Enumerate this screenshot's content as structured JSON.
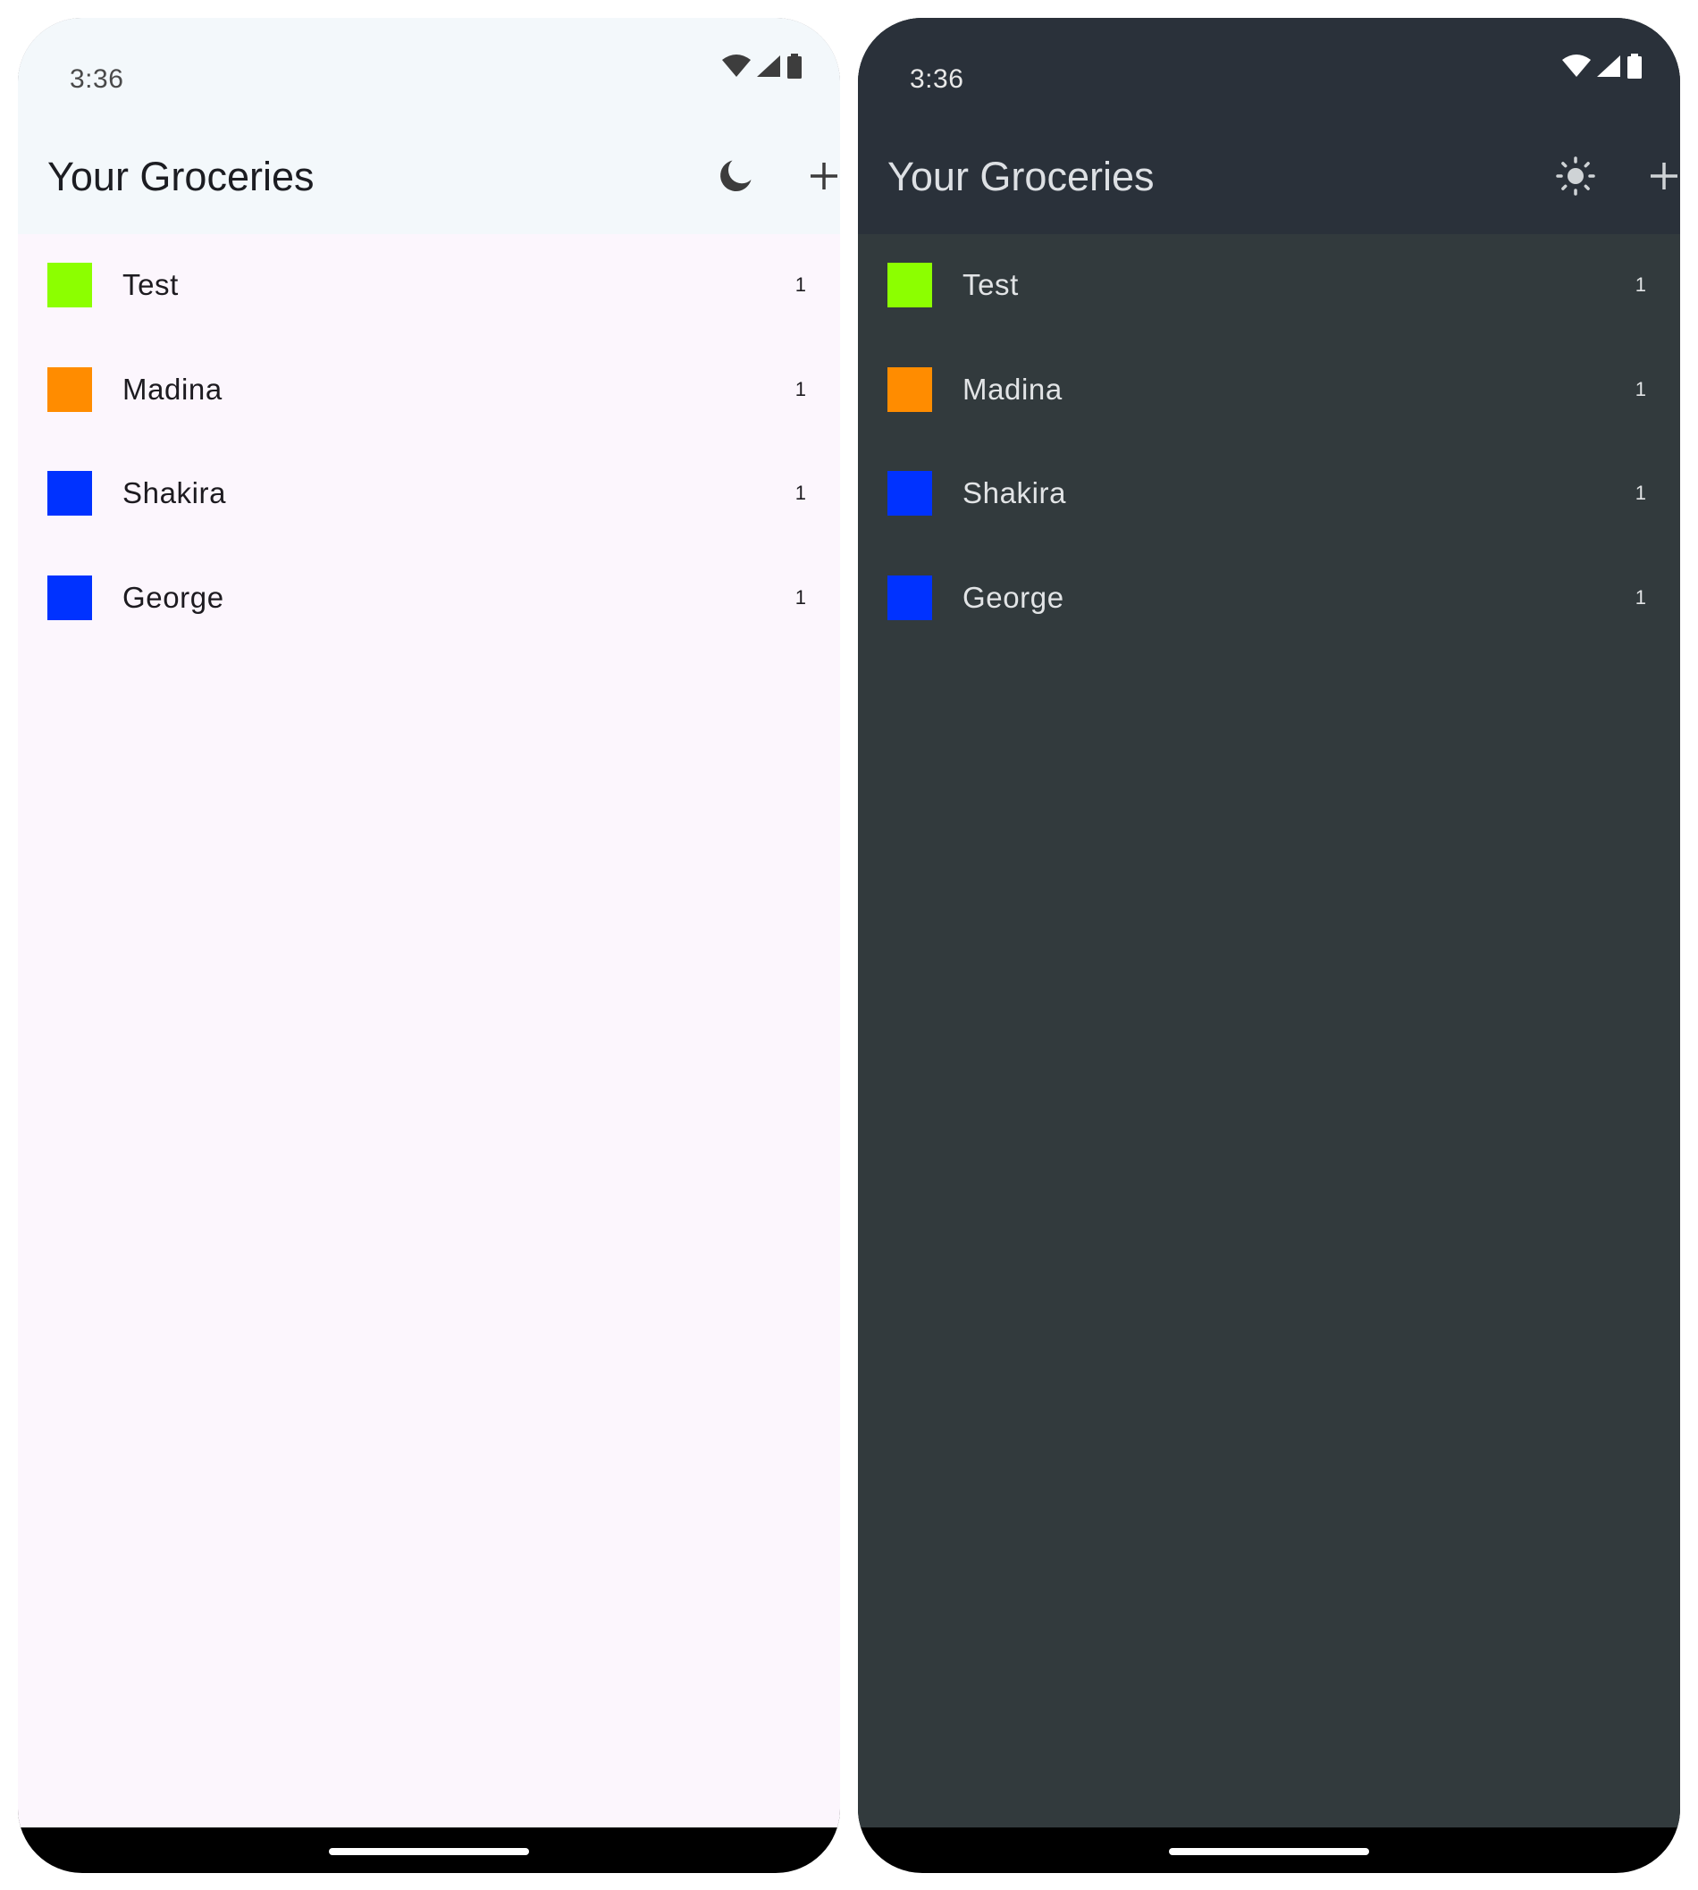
{
  "colors": {
    "light_background": "#fcf6fd",
    "light_app_bar": "#f3f8fb",
    "dark_background": "#323a3d",
    "dark_app_bar": "#2a313a"
  },
  "screens": [
    {
      "theme": "light",
      "status_bar": {
        "time": "3:36",
        "icons": [
          "wifi-icon",
          "signal-icon",
          "battery-icon"
        ]
      },
      "app_bar": {
        "title": "Your Groceries",
        "theme_toggle_icon": "moon-icon",
        "add_icon": "plus-icon"
      },
      "items": [
        {
          "name": "Test",
          "quantity": "1",
          "color": "#8cff00"
        },
        {
          "name": "Madina",
          "quantity": "1",
          "color": "#ff8c00"
        },
        {
          "name": "Shakira",
          "quantity": "1",
          "color": "#0032ff"
        },
        {
          "name": "George",
          "quantity": "1",
          "color": "#0032ff"
        }
      ]
    },
    {
      "theme": "dark",
      "status_bar": {
        "time": "3:36",
        "icons": [
          "wifi-icon",
          "signal-icon",
          "battery-icon"
        ]
      },
      "app_bar": {
        "title": "Your Groceries",
        "theme_toggle_icon": "sun-icon",
        "add_icon": "plus-icon"
      },
      "items": [
        {
          "name": "Test",
          "quantity": "1",
          "color": "#8cff00"
        },
        {
          "name": "Madina",
          "quantity": "1",
          "color": "#ff8c00"
        },
        {
          "name": "Shakira",
          "quantity": "1",
          "color": "#0032ff"
        },
        {
          "name": "George",
          "quantity": "1",
          "color": "#0032ff"
        }
      ]
    }
  ]
}
